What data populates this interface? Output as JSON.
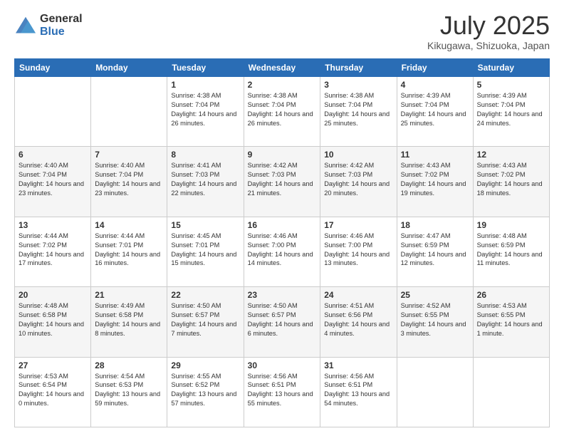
{
  "logo": {
    "general": "General",
    "blue": "Blue"
  },
  "title": "July 2025",
  "location": "Kikugawa, Shizuoka, Japan",
  "weekdays": [
    "Sunday",
    "Monday",
    "Tuesday",
    "Wednesday",
    "Thursday",
    "Friday",
    "Saturday"
  ],
  "weeks": [
    [
      {
        "day": "",
        "info": ""
      },
      {
        "day": "",
        "info": ""
      },
      {
        "day": "1",
        "info": "Sunrise: 4:38 AM\nSunset: 7:04 PM\nDaylight: 14 hours and 26 minutes."
      },
      {
        "day": "2",
        "info": "Sunrise: 4:38 AM\nSunset: 7:04 PM\nDaylight: 14 hours and 26 minutes."
      },
      {
        "day": "3",
        "info": "Sunrise: 4:38 AM\nSunset: 7:04 PM\nDaylight: 14 hours and 25 minutes."
      },
      {
        "day": "4",
        "info": "Sunrise: 4:39 AM\nSunset: 7:04 PM\nDaylight: 14 hours and 25 minutes."
      },
      {
        "day": "5",
        "info": "Sunrise: 4:39 AM\nSunset: 7:04 PM\nDaylight: 14 hours and 24 minutes."
      }
    ],
    [
      {
        "day": "6",
        "info": "Sunrise: 4:40 AM\nSunset: 7:04 PM\nDaylight: 14 hours and 23 minutes."
      },
      {
        "day": "7",
        "info": "Sunrise: 4:40 AM\nSunset: 7:04 PM\nDaylight: 14 hours and 23 minutes."
      },
      {
        "day": "8",
        "info": "Sunrise: 4:41 AM\nSunset: 7:03 PM\nDaylight: 14 hours and 22 minutes."
      },
      {
        "day": "9",
        "info": "Sunrise: 4:42 AM\nSunset: 7:03 PM\nDaylight: 14 hours and 21 minutes."
      },
      {
        "day": "10",
        "info": "Sunrise: 4:42 AM\nSunset: 7:03 PM\nDaylight: 14 hours and 20 minutes."
      },
      {
        "day": "11",
        "info": "Sunrise: 4:43 AM\nSunset: 7:02 PM\nDaylight: 14 hours and 19 minutes."
      },
      {
        "day": "12",
        "info": "Sunrise: 4:43 AM\nSunset: 7:02 PM\nDaylight: 14 hours and 18 minutes."
      }
    ],
    [
      {
        "day": "13",
        "info": "Sunrise: 4:44 AM\nSunset: 7:02 PM\nDaylight: 14 hours and 17 minutes."
      },
      {
        "day": "14",
        "info": "Sunrise: 4:44 AM\nSunset: 7:01 PM\nDaylight: 14 hours and 16 minutes."
      },
      {
        "day": "15",
        "info": "Sunrise: 4:45 AM\nSunset: 7:01 PM\nDaylight: 14 hours and 15 minutes."
      },
      {
        "day": "16",
        "info": "Sunrise: 4:46 AM\nSunset: 7:00 PM\nDaylight: 14 hours and 14 minutes."
      },
      {
        "day": "17",
        "info": "Sunrise: 4:46 AM\nSunset: 7:00 PM\nDaylight: 14 hours and 13 minutes."
      },
      {
        "day": "18",
        "info": "Sunrise: 4:47 AM\nSunset: 6:59 PM\nDaylight: 14 hours and 12 minutes."
      },
      {
        "day": "19",
        "info": "Sunrise: 4:48 AM\nSunset: 6:59 PM\nDaylight: 14 hours and 11 minutes."
      }
    ],
    [
      {
        "day": "20",
        "info": "Sunrise: 4:48 AM\nSunset: 6:58 PM\nDaylight: 14 hours and 10 minutes."
      },
      {
        "day": "21",
        "info": "Sunrise: 4:49 AM\nSunset: 6:58 PM\nDaylight: 14 hours and 8 minutes."
      },
      {
        "day": "22",
        "info": "Sunrise: 4:50 AM\nSunset: 6:57 PM\nDaylight: 14 hours and 7 minutes."
      },
      {
        "day": "23",
        "info": "Sunrise: 4:50 AM\nSunset: 6:57 PM\nDaylight: 14 hours and 6 minutes."
      },
      {
        "day": "24",
        "info": "Sunrise: 4:51 AM\nSunset: 6:56 PM\nDaylight: 14 hours and 4 minutes."
      },
      {
        "day": "25",
        "info": "Sunrise: 4:52 AM\nSunset: 6:55 PM\nDaylight: 14 hours and 3 minutes."
      },
      {
        "day": "26",
        "info": "Sunrise: 4:53 AM\nSunset: 6:55 PM\nDaylight: 14 hours and 1 minute."
      }
    ],
    [
      {
        "day": "27",
        "info": "Sunrise: 4:53 AM\nSunset: 6:54 PM\nDaylight: 14 hours and 0 minutes."
      },
      {
        "day": "28",
        "info": "Sunrise: 4:54 AM\nSunset: 6:53 PM\nDaylight: 13 hours and 59 minutes."
      },
      {
        "day": "29",
        "info": "Sunrise: 4:55 AM\nSunset: 6:52 PM\nDaylight: 13 hours and 57 minutes."
      },
      {
        "day": "30",
        "info": "Sunrise: 4:56 AM\nSunset: 6:51 PM\nDaylight: 13 hours and 55 minutes."
      },
      {
        "day": "31",
        "info": "Sunrise: 4:56 AM\nSunset: 6:51 PM\nDaylight: 13 hours and 54 minutes."
      },
      {
        "day": "",
        "info": ""
      },
      {
        "day": "",
        "info": ""
      }
    ]
  ]
}
